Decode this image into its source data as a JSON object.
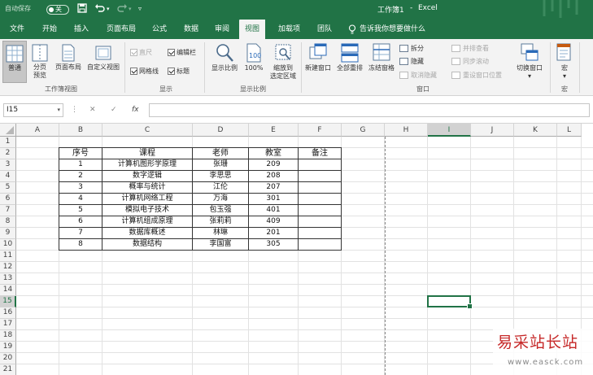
{
  "title_bar": {
    "autosave_label": "自动保存",
    "autosave_state": "关",
    "document_title": "工作簿1",
    "separator": "-",
    "app_name": "Excel"
  },
  "tabs": [
    {
      "label": "文件"
    },
    {
      "label": "开始"
    },
    {
      "label": "插入"
    },
    {
      "label": "页面布局"
    },
    {
      "label": "公式"
    },
    {
      "label": "数据"
    },
    {
      "label": "审阅"
    },
    {
      "label": "视图",
      "active": true
    },
    {
      "label": "加载项"
    },
    {
      "label": "团队"
    }
  ],
  "tell_me": "告诉我你想要做什么",
  "ribbon": {
    "workbook_views": {
      "group_label": "工作簿视图",
      "normal": "普通",
      "page_break_1": "分页",
      "page_break_2": "预览",
      "page_layout": "页面布局",
      "custom_views": "自定义视图"
    },
    "show": {
      "group_label": "显示",
      "ruler": "直尺",
      "formula_bar": "编辑栏",
      "gridlines": "网格线",
      "headings": "标题"
    },
    "zoom": {
      "group_label": "显示比例",
      "zoom": "显示比例",
      "zoom_100": "100%",
      "zoom_selection_1": "缩放到",
      "zoom_selection_2": "选定区域"
    },
    "window": {
      "group_label": "窗口",
      "new_window": "新建窗口",
      "arrange_all": "全部重排",
      "freeze_panes": "冻结窗格",
      "split": "拆分",
      "hide": "隐藏",
      "unhide": "取消隐藏",
      "view_side_by_side": "并排查看",
      "sync_scrolling": "同步滚动",
      "reset_position": "重设窗口位置",
      "switch_windows": "切换窗口"
    },
    "macros": {
      "group_label": "宏",
      "macros": "宏"
    }
  },
  "formula_bar": {
    "name_box": "I15",
    "cancel": "✕",
    "enter": "✓",
    "fx": "fx",
    "value": ""
  },
  "grid": {
    "columns": [
      "A",
      "B",
      "C",
      "D",
      "E",
      "F",
      "G",
      "H",
      "I",
      "J",
      "K",
      "L"
    ],
    "rows": [
      "1",
      "2",
      "3",
      "4",
      "5",
      "6",
      "7",
      "8",
      "9",
      "10",
      "11",
      "12",
      "13",
      "14",
      "15",
      "16",
      "17",
      "18",
      "19",
      "20",
      "21"
    ],
    "selected_cell": "I15",
    "table": {
      "headers": [
        "序号",
        "课程",
        "老师",
        "教室",
        "备注"
      ],
      "rows": [
        [
          "1",
          "计算机图形学原理",
          "张珊",
          "209",
          ""
        ],
        [
          "2",
          "数字逻辑",
          "李思思",
          "208",
          ""
        ],
        [
          "3",
          "概率与统计",
          "江伦",
          "207",
          ""
        ],
        [
          "4",
          "计算机网络工程",
          "万海",
          "301",
          ""
        ],
        [
          "5",
          "模拟电子技术",
          "包玉强",
          "401",
          ""
        ],
        [
          "6",
          "计算机组成原理",
          "张莉莉",
          "409",
          ""
        ],
        [
          "7",
          "数据库概述",
          "林琳",
          "201",
          ""
        ],
        [
          "8",
          "数据结构",
          "李国富",
          "305",
          ""
        ]
      ]
    }
  },
  "watermark": {
    "text": "易采站长站",
    "url": "www.easck.com"
  },
  "colors": {
    "excel_green": "#217346",
    "ribbon_bg": "#f3f3f3",
    "watermark_red": "#c62828"
  }
}
